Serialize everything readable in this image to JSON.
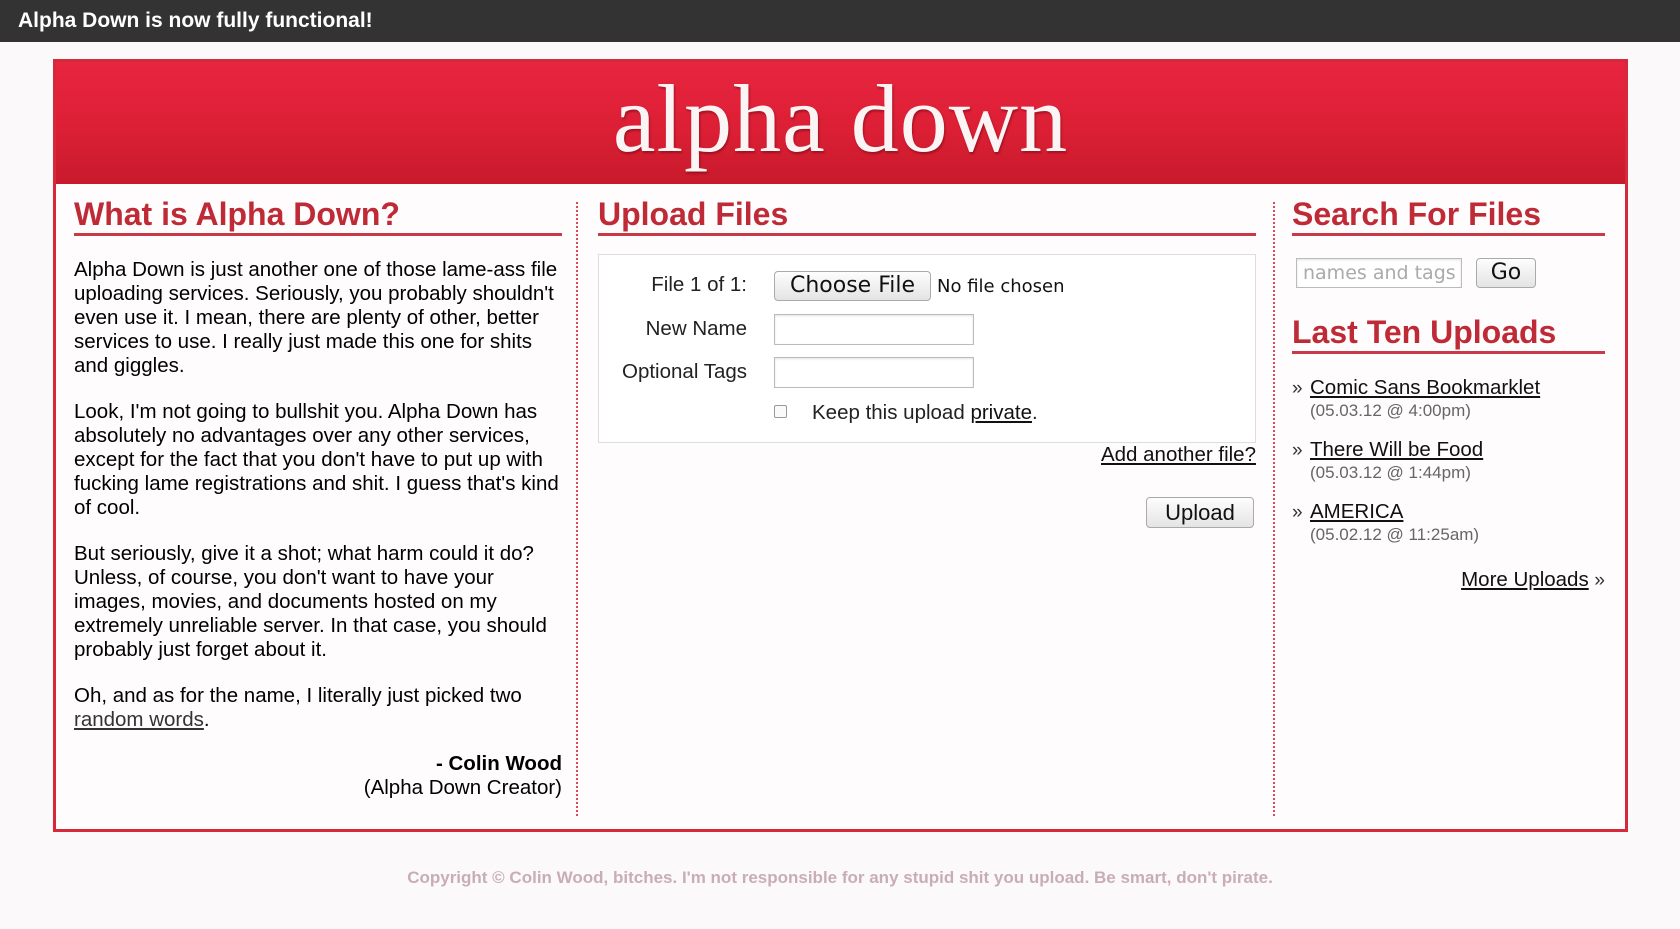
{
  "notice": "Alpha Down is now fully functional!",
  "logo": "alpha down",
  "about": {
    "title": "What is Alpha Down?",
    "p1": "Alpha Down is just another one of those lame-ass file uploading services. Seriously, you probably shouldn't even use it. I mean, there are plenty of other, better services to use. I really just made this one for shits and giggles.",
    "p2": "Look, I'm not going to bullshit you. Alpha Down has absolutely no advantages over any other services, except for the fact that you don't have to put up with fucking lame registrations and shit. I guess that's kind of cool.",
    "p3": "But seriously, give it a shot; what harm could it do? Unless, of course, you don't want to have your images, movies, and documents hosted on my extremely unreliable server. In that case, you should probably just forget about it.",
    "p4_before": "Oh, and as for the name, I literally just picked two ",
    "p4_link": "random words",
    "p4_after": ".",
    "sig_name": "- Colin Wood",
    "sig_role": "(Alpha Down Creator)"
  },
  "upload": {
    "title": "Upload Files",
    "file_label": "File 1 of 1:",
    "choose_button": "Choose File",
    "no_file": "No file chosen",
    "name_label": "New Name",
    "name_value": "",
    "tags_label": "Optional Tags",
    "tags_value": "",
    "private_before": "Keep this upload ",
    "private_link": "private",
    "private_after": ".",
    "add_another": "Add another file?",
    "upload_button": "Upload"
  },
  "search": {
    "title": "Search For Files",
    "placeholder": "names and tags",
    "go_button": "Go"
  },
  "recent": {
    "title": "Last Ten Uploads",
    "bullet": "»",
    "items": [
      {
        "name": "Comic Sans Bookmarklet",
        "date": "(05.03.12 @ 4:00pm)"
      },
      {
        "name": "There Will be Food",
        "date": "(05.03.12 @ 1:44pm)"
      },
      {
        "name": "AMERICA",
        "date": "(05.02.12 @ 11:25am)"
      }
    ],
    "more_label": "More Uploads",
    "more_bullet": "»"
  },
  "footer": "Copyright © Colin Wood, bitches. I'm not responsible for any stupid shit you upload. Be smart, don't pirate.",
  "colors": {
    "brand_red": "#dc1f35",
    "heading_red": "#bf2a37",
    "notice_bg": "#333334"
  }
}
